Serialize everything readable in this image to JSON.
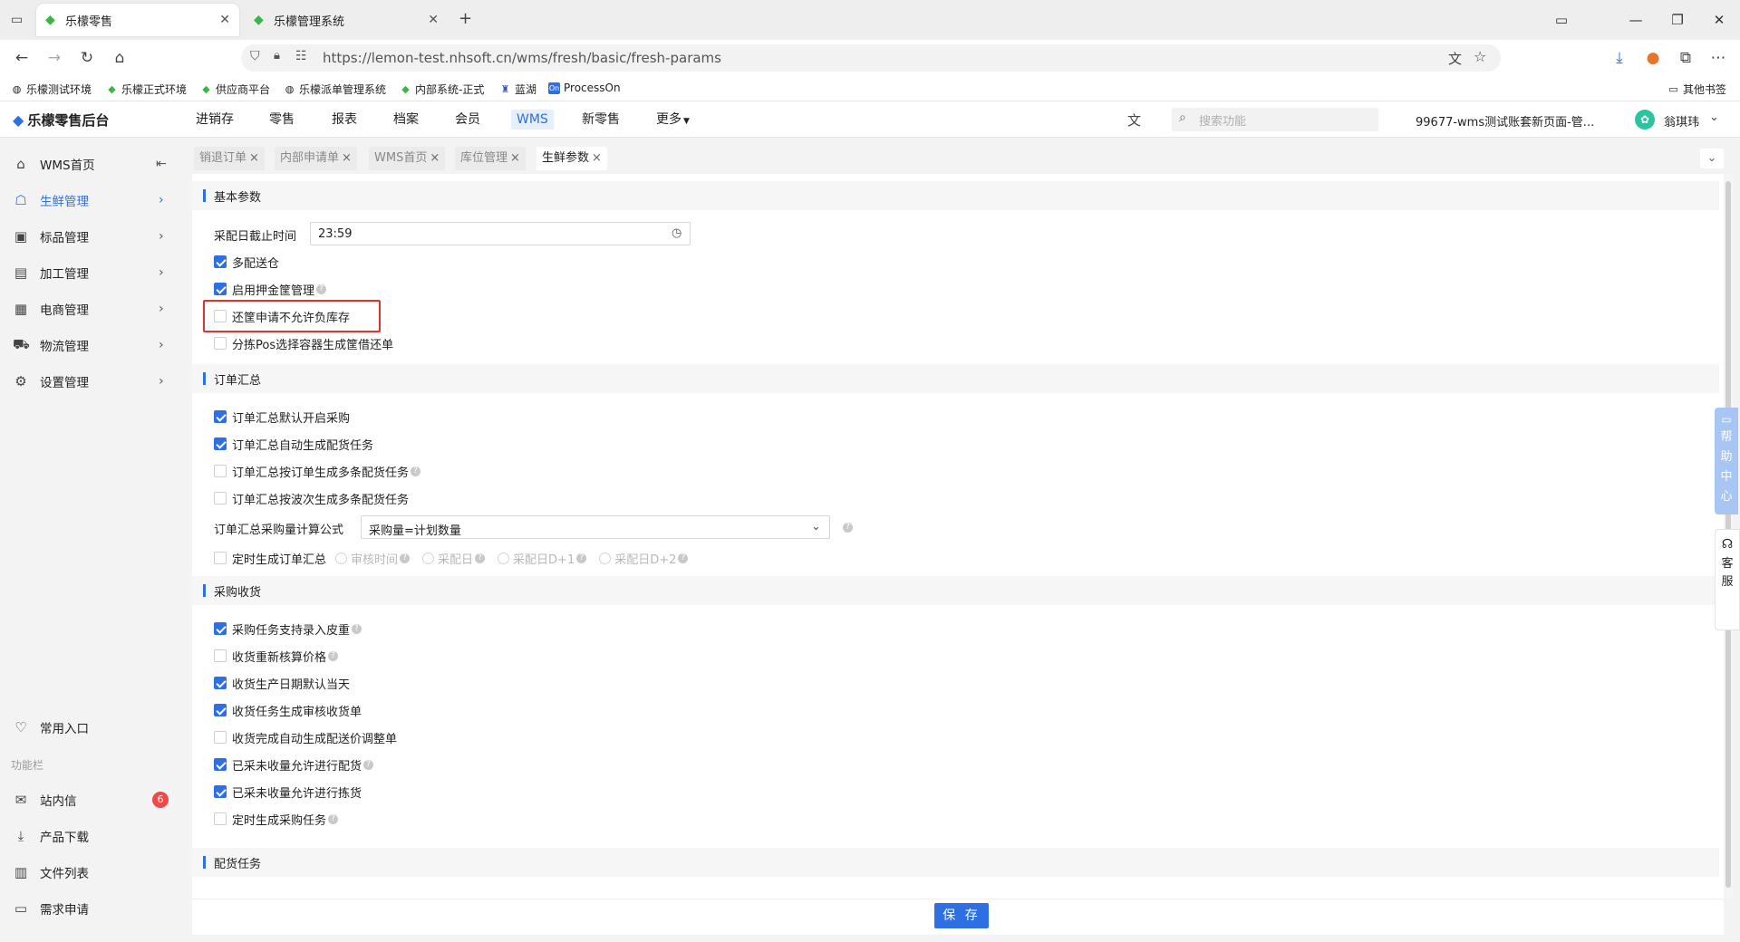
{
  "browser": {
    "tabs": [
      {
        "label": "乐檬零售",
        "active": true
      },
      {
        "label": "乐檬管理系统",
        "active": false
      }
    ],
    "url": "https://lemon-test.nhsoft.cn/wms/fresh/basic/fresh-params",
    "bookmarks": [
      "乐檬测试环境",
      "乐檬正式环境",
      "供应商平台",
      "乐檬派单管理系统",
      "内部系统-正式",
      "蓝湖",
      "ProcessOn"
    ],
    "other_bookmarks": "其他书签"
  },
  "app": {
    "logo": "乐檬零售后台",
    "menu": [
      "进销存",
      "零售",
      "报表",
      "档案",
      "会员",
      "WMS",
      "新零售",
      "更多"
    ],
    "active_menu": "WMS",
    "search_placeholder": "搜索功能",
    "account": "99677-wms测试账套新页面-管...",
    "user": "翁琪玮"
  },
  "sidebar": {
    "items": [
      {
        "label": "WMS首页",
        "icon": "home-icon"
      },
      {
        "label": "生鲜管理",
        "icon": "fresh-icon",
        "active": true
      },
      {
        "label": "标品管理",
        "icon": "box-icon"
      },
      {
        "label": "加工管理",
        "icon": "process-icon"
      },
      {
        "label": "电商管理",
        "icon": "shop-icon"
      },
      {
        "label": "物流管理",
        "icon": "truck-icon"
      },
      {
        "label": "设置管理",
        "icon": "gear-icon"
      }
    ],
    "favorites": "常用入口",
    "tools_title": "功能栏",
    "tools": [
      {
        "label": "站内信",
        "badge": "6"
      },
      {
        "label": "产品下载"
      },
      {
        "label": "文件列表"
      },
      {
        "label": "需求申请"
      }
    ]
  },
  "page_tabs": [
    "销退订单",
    "内部申请单",
    "WMS首页",
    "库位管理",
    "生鲜参数"
  ],
  "content": {
    "sections": {
      "basic": "基本参数",
      "order_summary": "订单汇总",
      "purchase": "采购收货",
      "dispatch": "配货任务"
    },
    "cutoff_label": "采配日截止时间",
    "cutoff_value": "23:59",
    "basic_items": [
      {
        "label": "多配送仓",
        "checked": true
      },
      {
        "label": "启用押金筐管理",
        "checked": true,
        "help": true
      },
      {
        "label": "还筐申请不允许负库存",
        "checked": false
      },
      {
        "label": "分拣Pos选择容器生成筐借还单",
        "checked": false
      }
    ],
    "summary_items": [
      {
        "label": "订单汇总默认开启采购",
        "checked": true
      },
      {
        "label": "订单汇总自动生成配货任务",
        "checked": true
      },
      {
        "label": "订单汇总按订单生成多条配货任务",
        "checked": false,
        "help": true
      },
      {
        "label": "订单汇总按波次生成多条配货任务",
        "checked": false
      }
    ],
    "formula_label": "订单汇总采购量计算公式",
    "formula_value": "采购量=计划数量",
    "timed_label": "定时生成订单汇总",
    "timed_options": [
      "审核时间",
      "采配日",
      "采配日D+1",
      "采配日D+2"
    ],
    "purchase_items": [
      {
        "label": "采购任务支持录入皮重",
        "checked": true,
        "help": true
      },
      {
        "label": "收货重新核算价格",
        "checked": false,
        "help": true
      },
      {
        "label": "收货生产日期默认当天",
        "checked": true
      },
      {
        "label": "收货任务生成审核收货单",
        "checked": true
      },
      {
        "label": "收货完成自动生成配送价调整单",
        "checked": false
      },
      {
        "label": "已采未收量允许进行配货",
        "checked": true,
        "help": true
      },
      {
        "label": "已采未收量允许进行拣货",
        "checked": true
      },
      {
        "label": "定时生成采购任务",
        "checked": false,
        "help": true
      }
    ],
    "save_label": "保 存"
  },
  "floating": {
    "help_center": "帮助中心",
    "customer_service": "客服"
  }
}
